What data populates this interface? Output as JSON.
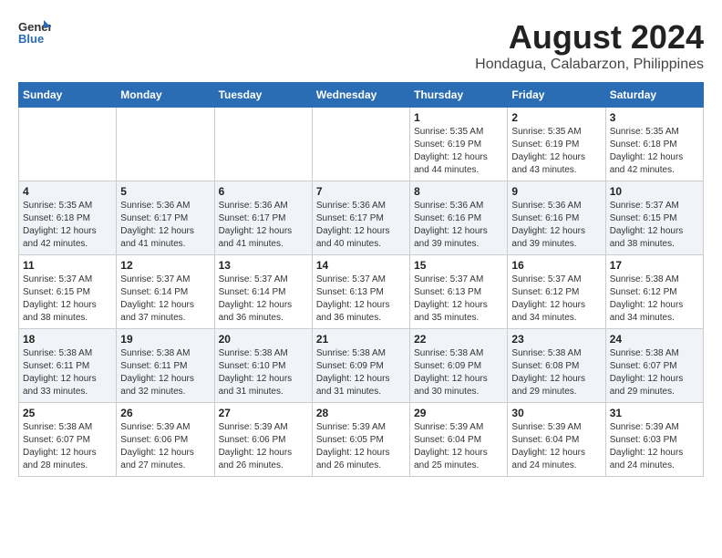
{
  "header": {
    "logo_line1": "General",
    "logo_line2": "Blue",
    "main_title": "August 2024",
    "subtitle": "Hondagua, Calabarzon, Philippines"
  },
  "days_of_week": [
    "Sunday",
    "Monday",
    "Tuesday",
    "Wednesday",
    "Thursday",
    "Friday",
    "Saturday"
  ],
  "weeks": [
    [
      {
        "day": "",
        "content": ""
      },
      {
        "day": "",
        "content": ""
      },
      {
        "day": "",
        "content": ""
      },
      {
        "day": "",
        "content": ""
      },
      {
        "day": "1",
        "content": "Sunrise: 5:35 AM\nSunset: 6:19 PM\nDaylight: 12 hours\nand 44 minutes."
      },
      {
        "day": "2",
        "content": "Sunrise: 5:35 AM\nSunset: 6:19 PM\nDaylight: 12 hours\nand 43 minutes."
      },
      {
        "day": "3",
        "content": "Sunrise: 5:35 AM\nSunset: 6:18 PM\nDaylight: 12 hours\nand 42 minutes."
      }
    ],
    [
      {
        "day": "4",
        "content": "Sunrise: 5:35 AM\nSunset: 6:18 PM\nDaylight: 12 hours\nand 42 minutes."
      },
      {
        "day": "5",
        "content": "Sunrise: 5:36 AM\nSunset: 6:17 PM\nDaylight: 12 hours\nand 41 minutes."
      },
      {
        "day": "6",
        "content": "Sunrise: 5:36 AM\nSunset: 6:17 PM\nDaylight: 12 hours\nand 41 minutes."
      },
      {
        "day": "7",
        "content": "Sunrise: 5:36 AM\nSunset: 6:17 PM\nDaylight: 12 hours\nand 40 minutes."
      },
      {
        "day": "8",
        "content": "Sunrise: 5:36 AM\nSunset: 6:16 PM\nDaylight: 12 hours\nand 39 minutes."
      },
      {
        "day": "9",
        "content": "Sunrise: 5:36 AM\nSunset: 6:16 PM\nDaylight: 12 hours\nand 39 minutes."
      },
      {
        "day": "10",
        "content": "Sunrise: 5:37 AM\nSunset: 6:15 PM\nDaylight: 12 hours\nand 38 minutes."
      }
    ],
    [
      {
        "day": "11",
        "content": "Sunrise: 5:37 AM\nSunset: 6:15 PM\nDaylight: 12 hours\nand 38 minutes."
      },
      {
        "day": "12",
        "content": "Sunrise: 5:37 AM\nSunset: 6:14 PM\nDaylight: 12 hours\nand 37 minutes."
      },
      {
        "day": "13",
        "content": "Sunrise: 5:37 AM\nSunset: 6:14 PM\nDaylight: 12 hours\nand 36 minutes."
      },
      {
        "day": "14",
        "content": "Sunrise: 5:37 AM\nSunset: 6:13 PM\nDaylight: 12 hours\nand 36 minutes."
      },
      {
        "day": "15",
        "content": "Sunrise: 5:37 AM\nSunset: 6:13 PM\nDaylight: 12 hours\nand 35 minutes."
      },
      {
        "day": "16",
        "content": "Sunrise: 5:37 AM\nSunset: 6:12 PM\nDaylight: 12 hours\nand 34 minutes."
      },
      {
        "day": "17",
        "content": "Sunrise: 5:38 AM\nSunset: 6:12 PM\nDaylight: 12 hours\nand 34 minutes."
      }
    ],
    [
      {
        "day": "18",
        "content": "Sunrise: 5:38 AM\nSunset: 6:11 PM\nDaylight: 12 hours\nand 33 minutes."
      },
      {
        "day": "19",
        "content": "Sunrise: 5:38 AM\nSunset: 6:11 PM\nDaylight: 12 hours\nand 32 minutes."
      },
      {
        "day": "20",
        "content": "Sunrise: 5:38 AM\nSunset: 6:10 PM\nDaylight: 12 hours\nand 31 minutes."
      },
      {
        "day": "21",
        "content": "Sunrise: 5:38 AM\nSunset: 6:09 PM\nDaylight: 12 hours\nand 31 minutes."
      },
      {
        "day": "22",
        "content": "Sunrise: 5:38 AM\nSunset: 6:09 PM\nDaylight: 12 hours\nand 30 minutes."
      },
      {
        "day": "23",
        "content": "Sunrise: 5:38 AM\nSunset: 6:08 PM\nDaylight: 12 hours\nand 29 minutes."
      },
      {
        "day": "24",
        "content": "Sunrise: 5:38 AM\nSunset: 6:07 PM\nDaylight: 12 hours\nand 29 minutes."
      }
    ],
    [
      {
        "day": "25",
        "content": "Sunrise: 5:38 AM\nSunset: 6:07 PM\nDaylight: 12 hours\nand 28 minutes."
      },
      {
        "day": "26",
        "content": "Sunrise: 5:39 AM\nSunset: 6:06 PM\nDaylight: 12 hours\nand 27 minutes."
      },
      {
        "day": "27",
        "content": "Sunrise: 5:39 AM\nSunset: 6:06 PM\nDaylight: 12 hours\nand 26 minutes."
      },
      {
        "day": "28",
        "content": "Sunrise: 5:39 AM\nSunset: 6:05 PM\nDaylight: 12 hours\nand 26 minutes."
      },
      {
        "day": "29",
        "content": "Sunrise: 5:39 AM\nSunset: 6:04 PM\nDaylight: 12 hours\nand 25 minutes."
      },
      {
        "day": "30",
        "content": "Sunrise: 5:39 AM\nSunset: 6:04 PM\nDaylight: 12 hours\nand 24 minutes."
      },
      {
        "day": "31",
        "content": "Sunrise: 5:39 AM\nSunset: 6:03 PM\nDaylight: 12 hours\nand 24 minutes."
      }
    ]
  ]
}
